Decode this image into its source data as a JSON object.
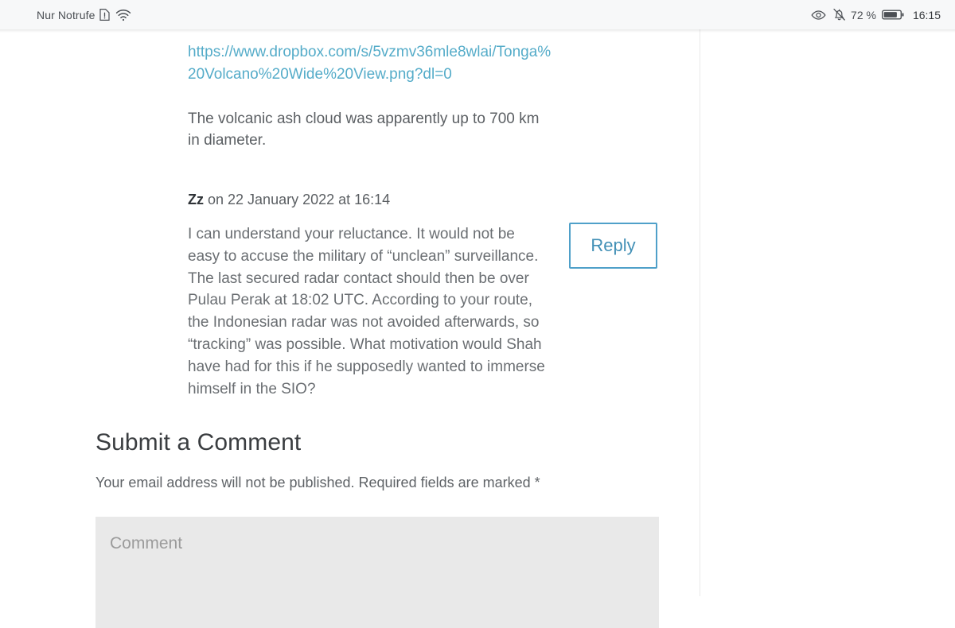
{
  "status_bar": {
    "carrier_text": "Nur Notrufe",
    "sim_icon": "sim-alert-icon",
    "wifi_icon": "wifi-icon",
    "eye_icon": "eye-icon",
    "bell_muted_icon": "bell-muted-icon",
    "battery_percent": "72 %",
    "battery_icon": "battery-icon",
    "clock": "16:15"
  },
  "article": {
    "link_text": "https://www.dropbox.com/s/5vzmv36mle8wlai/Tonga%20Volcano%20Wide%20View.png?dl=0",
    "paragraph": "The volcanic ash cloud was apparently up to 700 km in diameter."
  },
  "comment": {
    "author": "Zz",
    "meta_suffix": " on 22 January 2022 at 16:14",
    "body": "I can understand your reluctance. It would not be easy to accuse the military of “unclean” surveillance. The last secured radar contact should then be over Pulau Perak at 18:02 UTC. According to your route, the Indonesian radar was not avoided afterwards, so “tracking” was possible. What motivation would Shah have had for this if he supposedly wanted to immerse himself in the SIO?",
    "reply_label": "Reply"
  },
  "submit_form": {
    "heading": "Submit a Comment",
    "note": "Your email address will not be published. Required fields are marked *",
    "comment_placeholder": "Comment",
    "comment_value": ""
  },
  "colors": {
    "link": "#55acc9",
    "reply_border": "#4fa0c9",
    "reply_text": "#4290b6",
    "status_bar_bg": "#f7f8f9",
    "textarea_bg": "#e9e9e9",
    "body_text": "#6a6e72",
    "divider": "#eaeaea"
  }
}
